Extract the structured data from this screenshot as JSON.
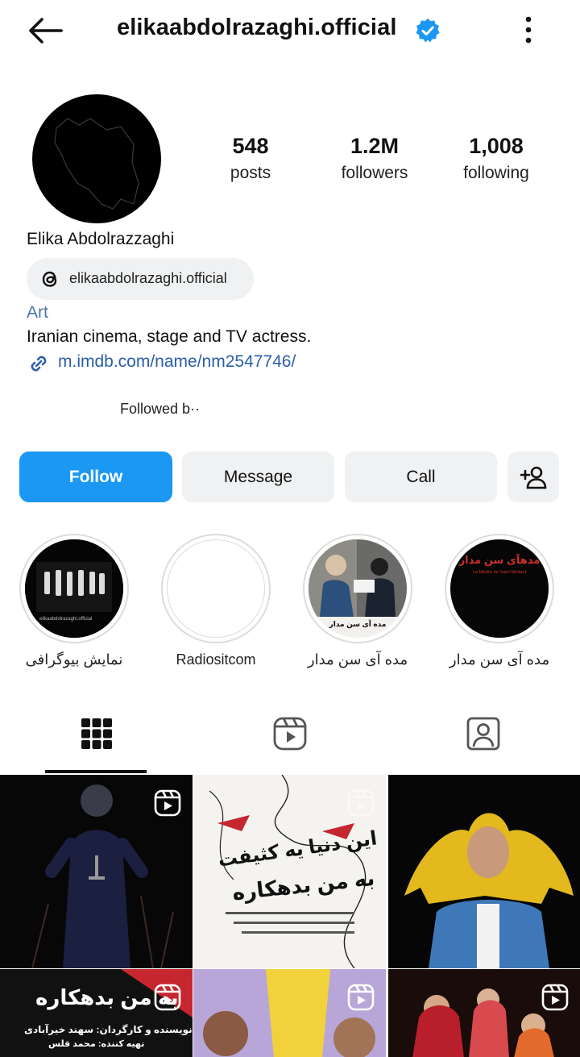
{
  "header": {
    "username": "elikaabdolrazaghi.official",
    "back_icon": "arrow-left-icon",
    "verified_icon": "verified-badge-icon",
    "more_icon": "more-vertical-icon"
  },
  "profile": {
    "avatar": "avatar",
    "stats": {
      "posts_count": "548",
      "posts_label": "posts",
      "followers_count": "1.2M",
      "followers_label": "followers",
      "following_count": "1,008",
      "following_label": "following"
    },
    "full_name": "Elika Abdolrazzaghi",
    "threads_handle": "elikaabdolrazaghi.official",
    "category": "Art",
    "bio": "Iranian cinema, stage and TV actress.",
    "link": "m.imdb.com/name/nm2547746/",
    "followed_by": "Followed b··"
  },
  "actions": {
    "follow": "Follow",
    "message": "Message",
    "call": "Call",
    "add_user_icon": "add-user-icon"
  },
  "highlights": [
    {
      "label": "نمایش بیوگرافی"
    },
    {
      "label": "Radiositcom"
    },
    {
      "label": "مده آی سن مدار"
    },
    {
      "label": "مده آی سن مدار"
    }
  ],
  "highlight_texts": {
    "poster_title": "مدهآی سن مدار",
    "poster_subtitle": "La Médée de Saint-Médard",
    "poster_caption": "مده آی سن مدار",
    "handle_tag": "elikaabdolrazaghi.official"
  },
  "tabs": [
    {
      "name": "grid-icon",
      "selected": true
    },
    {
      "name": "reels-icon",
      "selected": false
    },
    {
      "name": "tagged-icon",
      "selected": false
    }
  ],
  "grid_texts": {
    "poster2_title": "این دنیا یه کثیفت",
    "poster2_subtitle": "به من بدهکاره",
    "poster4_line1": "نویسنده و کارگردان: سهند خیرآبادی",
    "poster4_line2": "تهیه کننده: محمد قلس"
  },
  "colors": {
    "accent": "#1a98f3",
    "verified": "#1a98f3",
    "link": "#2b5ea8",
    "category": "#4a76a8"
  }
}
